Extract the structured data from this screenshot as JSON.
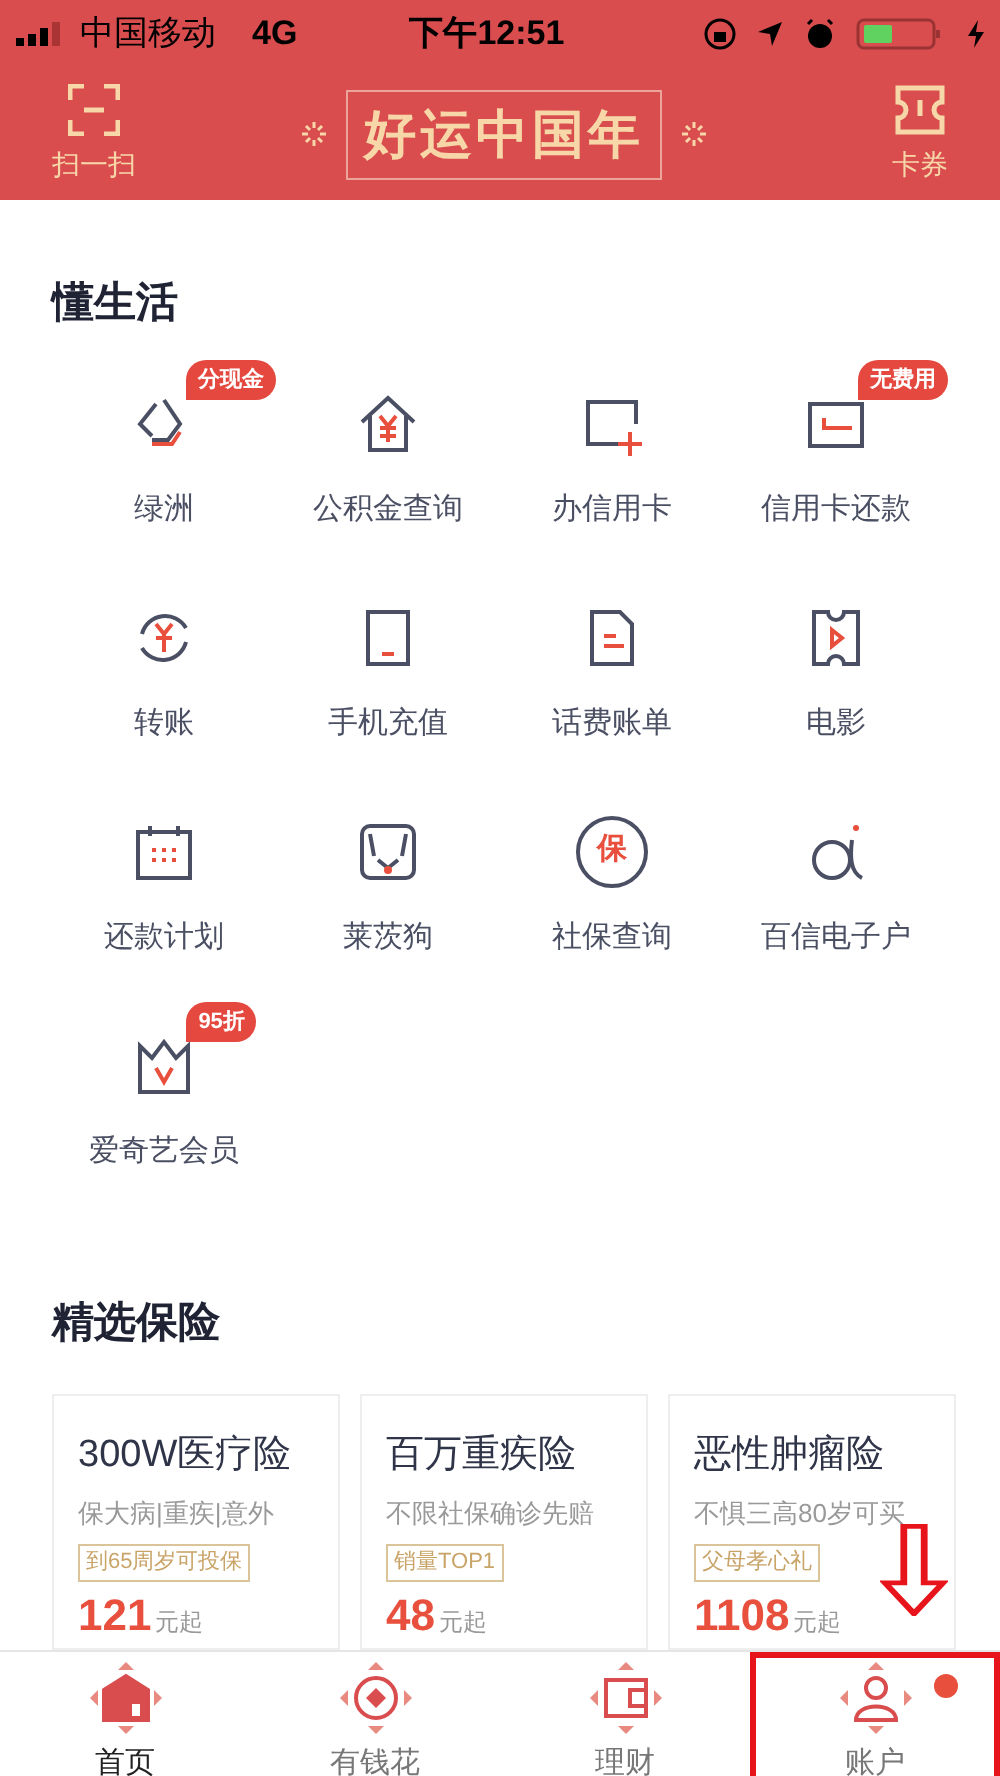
{
  "status_bar": {
    "carrier": "中国移动",
    "network": "4G",
    "time": "下午12:51"
  },
  "header": {
    "scan_label": "扫一扫",
    "banner_text": "好运中国年",
    "coupon_label": "卡券"
  },
  "services": {
    "title": "懂生活",
    "items": [
      {
        "label": "绿洲",
        "kind": "oasis",
        "badge": "分现金"
      },
      {
        "label": "公积金查询",
        "kind": "house"
      },
      {
        "label": "办信用卡",
        "kind": "card-add"
      },
      {
        "label": "信用卡还款",
        "kind": "card",
        "badge": "无费用"
      },
      {
        "label": "转账",
        "kind": "transfer"
      },
      {
        "label": "手机充值",
        "kind": "phone"
      },
      {
        "label": "话费账单",
        "kind": "bill"
      },
      {
        "label": "电影",
        "kind": "movie"
      },
      {
        "label": "还款计划",
        "kind": "calendar"
      },
      {
        "label": "莱茨狗",
        "kind": "dog"
      },
      {
        "label": "社保查询",
        "kind": "insurance",
        "glyph": "保"
      },
      {
        "label": "百信电子户",
        "kind": "alpha"
      },
      {
        "label": "爱奇艺会员",
        "kind": "crown",
        "badge": "95折"
      }
    ]
  },
  "insurance": {
    "title": "精选保险",
    "cards": [
      {
        "title": "300W医疗险",
        "subtitle": "保大病|重疾|意外",
        "tag": "到65周岁可投保",
        "price": "121",
        "unit": "元起"
      },
      {
        "title": "百万重疾险",
        "subtitle": "不限社保确诊先赔",
        "tag": "销量TOP1",
        "price": "48",
        "unit": "元起"
      },
      {
        "title": "恶性肿瘤险",
        "subtitle": "不惧三高80岁可买",
        "tag": "父母孝心礼",
        "price": "1108",
        "unit": "元起"
      }
    ]
  },
  "tab_bar": [
    {
      "label": "首页",
      "kind": "home",
      "selected": true,
      "dot": false
    },
    {
      "label": "有钱花",
      "kind": "coin",
      "selected": false,
      "dot": false
    },
    {
      "label": "理财",
      "kind": "wallet",
      "selected": false,
      "dot": false
    },
    {
      "label": "账户",
      "kind": "user",
      "selected": false,
      "dot": true,
      "highlighted": true
    }
  ]
}
